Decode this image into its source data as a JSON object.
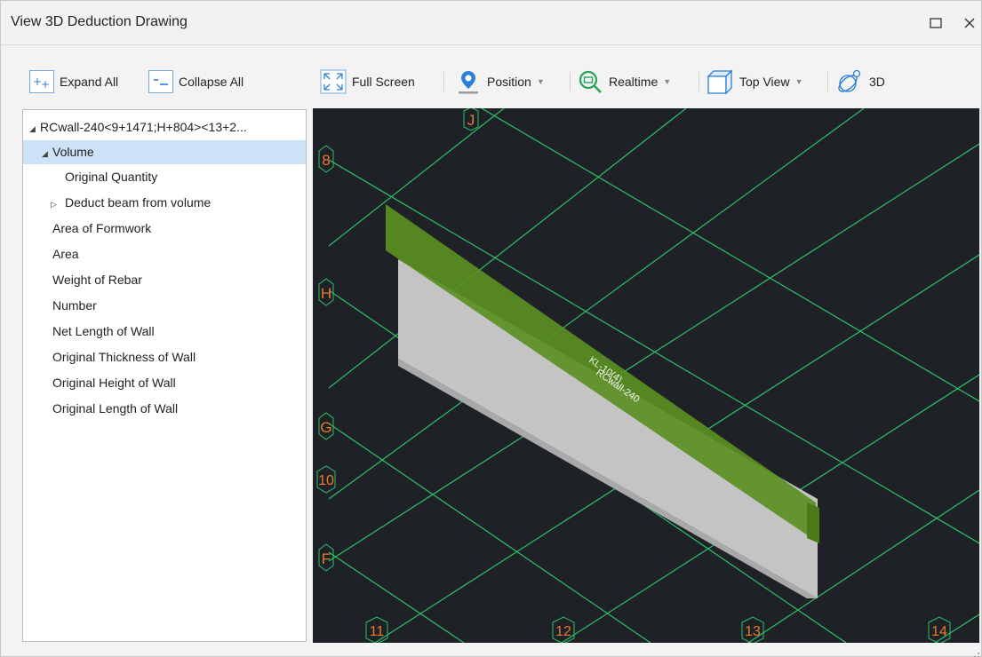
{
  "window": {
    "title": "View 3D Deduction Drawing"
  },
  "left_toolbar": {
    "expand_all": "Expand All",
    "collapse_all": "Collapse All"
  },
  "right_toolbar": {
    "full_screen": "Full Screen",
    "position": "Position",
    "realtime": "Realtime",
    "top_view": "Top View",
    "view_3d": "3D"
  },
  "tree": {
    "root": "RCwall-240<9+1471;H+804><13+2...",
    "volume": "Volume",
    "original_quantity": "Original Quantity",
    "deduct_beam": "Deduct beam from volume",
    "items": [
      "Area of Formwork",
      "Area",
      "Weight of Rebar",
      "Number",
      "Net Length of Wall",
      "Original Thickness of Wall",
      "Original Height of Wall",
      "Original Length of Wall"
    ]
  },
  "viewport": {
    "axis_labels": [
      "J",
      "8",
      "H",
      "G",
      "10",
      "F",
      "11",
      "12",
      "13",
      "14"
    ],
    "beam_label": "KL-10(4)",
    "wall_label": "RCwall-240"
  },
  "colors": {
    "accent": "#2b7fd6",
    "viewport_bg": "#1e2227",
    "grid_line": "#2fbf6a",
    "axis_label": "#e87a2a",
    "beam_green": "#5b8f22",
    "wall_grey": "#c8c8c8",
    "tree_selected": "#cce2f6"
  }
}
